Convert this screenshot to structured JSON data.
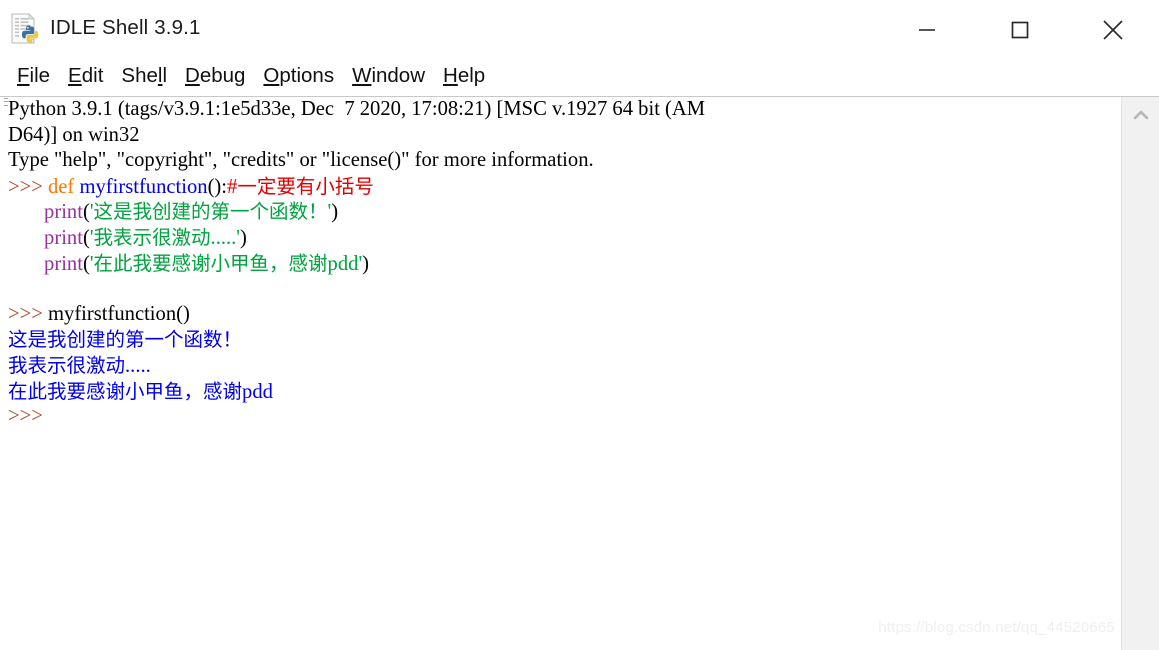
{
  "window": {
    "title": "IDLE Shell 3.9.1",
    "icon": "python-file-icon",
    "controls": {
      "minimize": "minimize-icon",
      "maximize": "maximize-icon",
      "close": "close-icon"
    }
  },
  "menu": {
    "items": [
      {
        "label": "File",
        "mnemonic_index": 0
      },
      {
        "label": "Edit",
        "mnemonic_index": 0
      },
      {
        "label": "Shell",
        "mnemonic_index": 3
      },
      {
        "label": "Debug",
        "mnemonic_index": 0
      },
      {
        "label": "Options",
        "mnemonic_index": 0
      },
      {
        "label": "Window",
        "mnemonic_index": 0
      },
      {
        "label": "Help",
        "mnemonic_index": 0
      }
    ]
  },
  "shell": {
    "banner": [
      "Python 3.9.1 (tags/v3.9.1:1e5d33e, Dec  7 2020, 17:08:21) [MSC v.1927 64 bit (AM",
      "D64)] on win32",
      "Type \"help\", \"copyright\", \"credits\" or \"license()\" for more information."
    ],
    "lines": [
      {
        "name": "line-def",
        "spans": [
          {
            "text": ">>> ",
            "token": "prompt"
          },
          {
            "text": "def ",
            "token": "kw"
          },
          {
            "text": "myfirstfunction",
            "token": "def"
          },
          {
            "text": "():",
            "token": "plain"
          },
          {
            "text": "#一定要有小括号",
            "token": "comment"
          }
        ]
      },
      {
        "name": "line-print-1",
        "spans": [
          {
            "text": "\t",
            "token": "plain"
          },
          {
            "text": "print",
            "token": "builtin"
          },
          {
            "text": "(",
            "token": "plain"
          },
          {
            "text": "'这是我创建的第一个函数！'",
            "token": "string"
          },
          {
            "text": ")",
            "token": "plain"
          }
        ]
      },
      {
        "name": "line-print-2",
        "spans": [
          {
            "text": "\t",
            "token": "plain"
          },
          {
            "text": "print",
            "token": "builtin"
          },
          {
            "text": "(",
            "token": "plain"
          },
          {
            "text": "'我表示很激动.....'",
            "token": "string"
          },
          {
            "text": ")",
            "token": "plain"
          }
        ]
      },
      {
        "name": "line-print-3",
        "spans": [
          {
            "text": "\t",
            "token": "plain"
          },
          {
            "text": "print",
            "token": "builtin"
          },
          {
            "text": "(",
            "token": "plain"
          },
          {
            "text": "'在此我要感谢小甲鱼，感谢pdd'",
            "token": "string"
          },
          {
            "text": ")",
            "token": "plain"
          }
        ]
      },
      {
        "name": "line-blank",
        "spans": []
      },
      {
        "name": "line-call",
        "spans": [
          {
            "text": ">>> ",
            "token": "prompt"
          },
          {
            "text": "myfirstfunction()",
            "token": "plain"
          }
        ]
      },
      {
        "name": "line-output-1",
        "spans": [
          {
            "text": "这是我创建的第一个函数！",
            "token": "output"
          }
        ]
      },
      {
        "name": "line-output-2",
        "spans": [
          {
            "text": "我表示很激动.....",
            "token": "output"
          }
        ]
      },
      {
        "name": "line-output-3",
        "spans": [
          {
            "text": "在此我要感谢小甲鱼，感谢pdd",
            "token": "output"
          }
        ]
      },
      {
        "name": "line-final-prompt",
        "spans": [
          {
            "text": ">>>",
            "token": "prompt"
          }
        ]
      }
    ]
  },
  "scrollbar": {
    "up_arrow": "chevron-up-icon"
  },
  "watermark": {
    "text": "https://blog.csdn.net/qq_44520665"
  },
  "colors": {
    "prompt": "#b0431f",
    "keyword": "#ff7700",
    "definition": "#0000ee",
    "comment": "#e00000",
    "builtin": "#9b30a0",
    "string": "#00a33f",
    "output": "#0000ee",
    "background": "#ffffff",
    "scrollbar": "#f1f1f1"
  }
}
